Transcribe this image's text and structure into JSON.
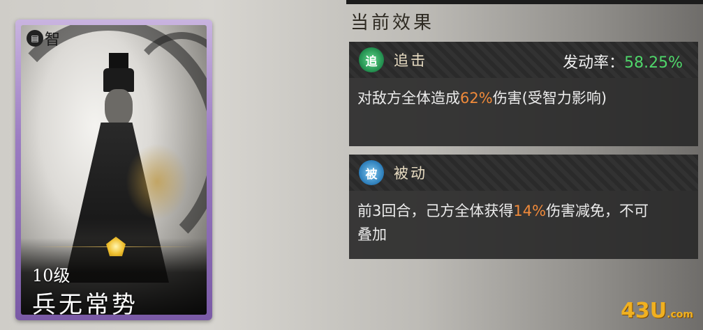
{
  "card": {
    "stat_label": "智",
    "level": "10级",
    "name": "兵无常势"
  },
  "panel": {
    "section_title": "当前效果",
    "effects": [
      {
        "icon_text": "追",
        "type": "追击",
        "rate_label": "发动率：",
        "rate_value": "58.25%",
        "desc_pre": "对敌方全体造成",
        "desc_hl": "62%",
        "desc_post": "伤害(受智力影响)"
      },
      {
        "icon_text": "被",
        "type": "被动",
        "desc_pre": "前3回合，己方全体获得",
        "desc_hl": "14%",
        "desc_post": "伤害减免，不可叠加"
      }
    ]
  },
  "watermark": {
    "main": "43U",
    "suffix": ".com"
  },
  "colors": {
    "rate_green": "#4fd66a",
    "highlight_orange": "#f08a3a",
    "card_frame_purple": "#9b7cc2"
  }
}
